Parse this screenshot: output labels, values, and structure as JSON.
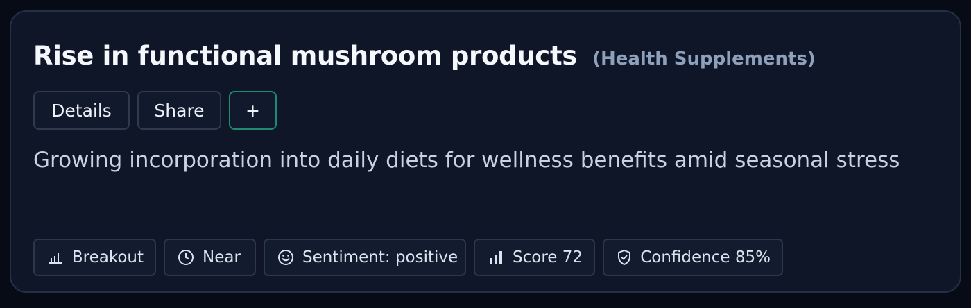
{
  "card": {
    "title": "Rise in functional mushroom products",
    "category": "(Health Supplements)",
    "description": "Growing incorporation into daily diets for wellness benefits amid seasonal stress"
  },
  "actions": {
    "details_label": "Details",
    "share_label": "Share",
    "add_label": "+"
  },
  "tags": [
    {
      "label": "Breakout",
      "icon": "bar-chart-icon"
    },
    {
      "label": "Near",
      "icon": "clock-icon"
    },
    {
      "label": "Sentiment: positive",
      "icon": "smile-icon"
    },
    {
      "label": "Score 72",
      "icon": "signal-bars-icon"
    },
    {
      "label": "Confidence 85%",
      "icon": "shield-check-icon"
    }
  ],
  "colors": {
    "background": "#070b16",
    "card": "#0e1628",
    "accent_border": "#1f8a6e",
    "title": "#f4f7fb",
    "muted": "#8fa0ba"
  }
}
